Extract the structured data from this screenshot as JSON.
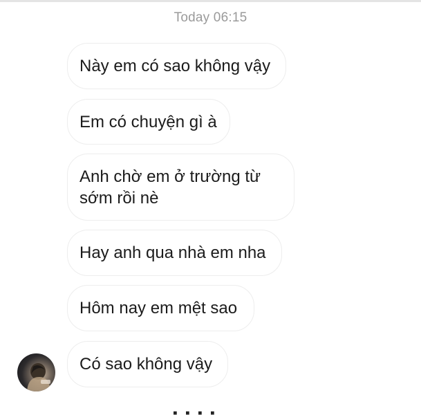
{
  "conversation": {
    "timestamp": "Today 06:15",
    "messages": [
      {
        "text": "Này em có sao không vậy"
      },
      {
        "text": "Em có chuyện gì à"
      },
      {
        "text": "Anh chờ em ở trường từ sớm rồi nè"
      },
      {
        "text": "Hay anh qua nhà em nha"
      },
      {
        "text": "Hôm nay em mệt sao"
      },
      {
        "text": "Có sao không vậy"
      }
    ],
    "sender_avatar": "contact-avatar-photo"
  }
}
